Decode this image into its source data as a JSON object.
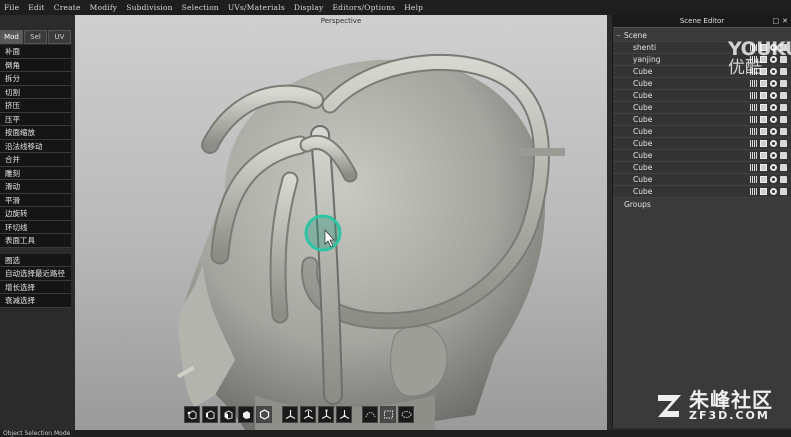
{
  "menubar": {
    "items": [
      "File",
      "Edit",
      "Create",
      "Modify",
      "Subdivision",
      "Selection",
      "UVs/Materials",
      "Display",
      "Editors/Options",
      "Help"
    ]
  },
  "left_panel": {
    "tabs": [
      "Mod",
      "Sel",
      "UV"
    ],
    "active_tab": "Mod",
    "tools": [
      "补面",
      "倒角",
      "拆分",
      "切割",
      "挤压",
      "压平",
      "按面缩放",
      "沿法线移动",
      "合并",
      "雕刻",
      "滑动",
      "平滑",
      "边旋转",
      "环切线",
      "表面工具"
    ],
    "selection_tools": [
      "圈选",
      "自动选择最近路径",
      "增长选择",
      "衰减选择"
    ]
  },
  "viewport": {
    "label": "Perspective",
    "toolbar_icons": [
      "cube-vertex-icon",
      "cube-edge-icon",
      "cube-face-icon",
      "cube-object-icon",
      "hexagon-object-icon",
      "move-icon",
      "rotate-icon",
      "scale-icon",
      "transform-icon",
      "falloff-curve-icon",
      "wire-mesh-icon",
      "soft-select-icon"
    ],
    "selected_toolbar_icon": "hexagon-object-icon"
  },
  "scene_editor": {
    "title": "Scene Editor",
    "root": "Scene",
    "items": [
      "shenti",
      "yanjing",
      "Cube",
      "Cube",
      "Cube",
      "Cube",
      "Cube",
      "Cube",
      "Cube",
      "Cube",
      "Cube",
      "Cube",
      "Cube"
    ],
    "groups_label": "Groups"
  },
  "status": {
    "text": "Object Selection Mode"
  },
  "watermarks": {
    "youku_brand": "YOUKU",
    "youku_cn": "优酷",
    "zf3d_cn": "朱峰社区",
    "zf3d_url": "ZF3D.COM"
  },
  "colors": {
    "menubar_bg": "#1e1e1e",
    "panel_bg": "#3a3a3a",
    "tool_button_bg": "#151515",
    "cursor_ring": "#2ec4a4",
    "model_gray": "#a7a8a2"
  }
}
